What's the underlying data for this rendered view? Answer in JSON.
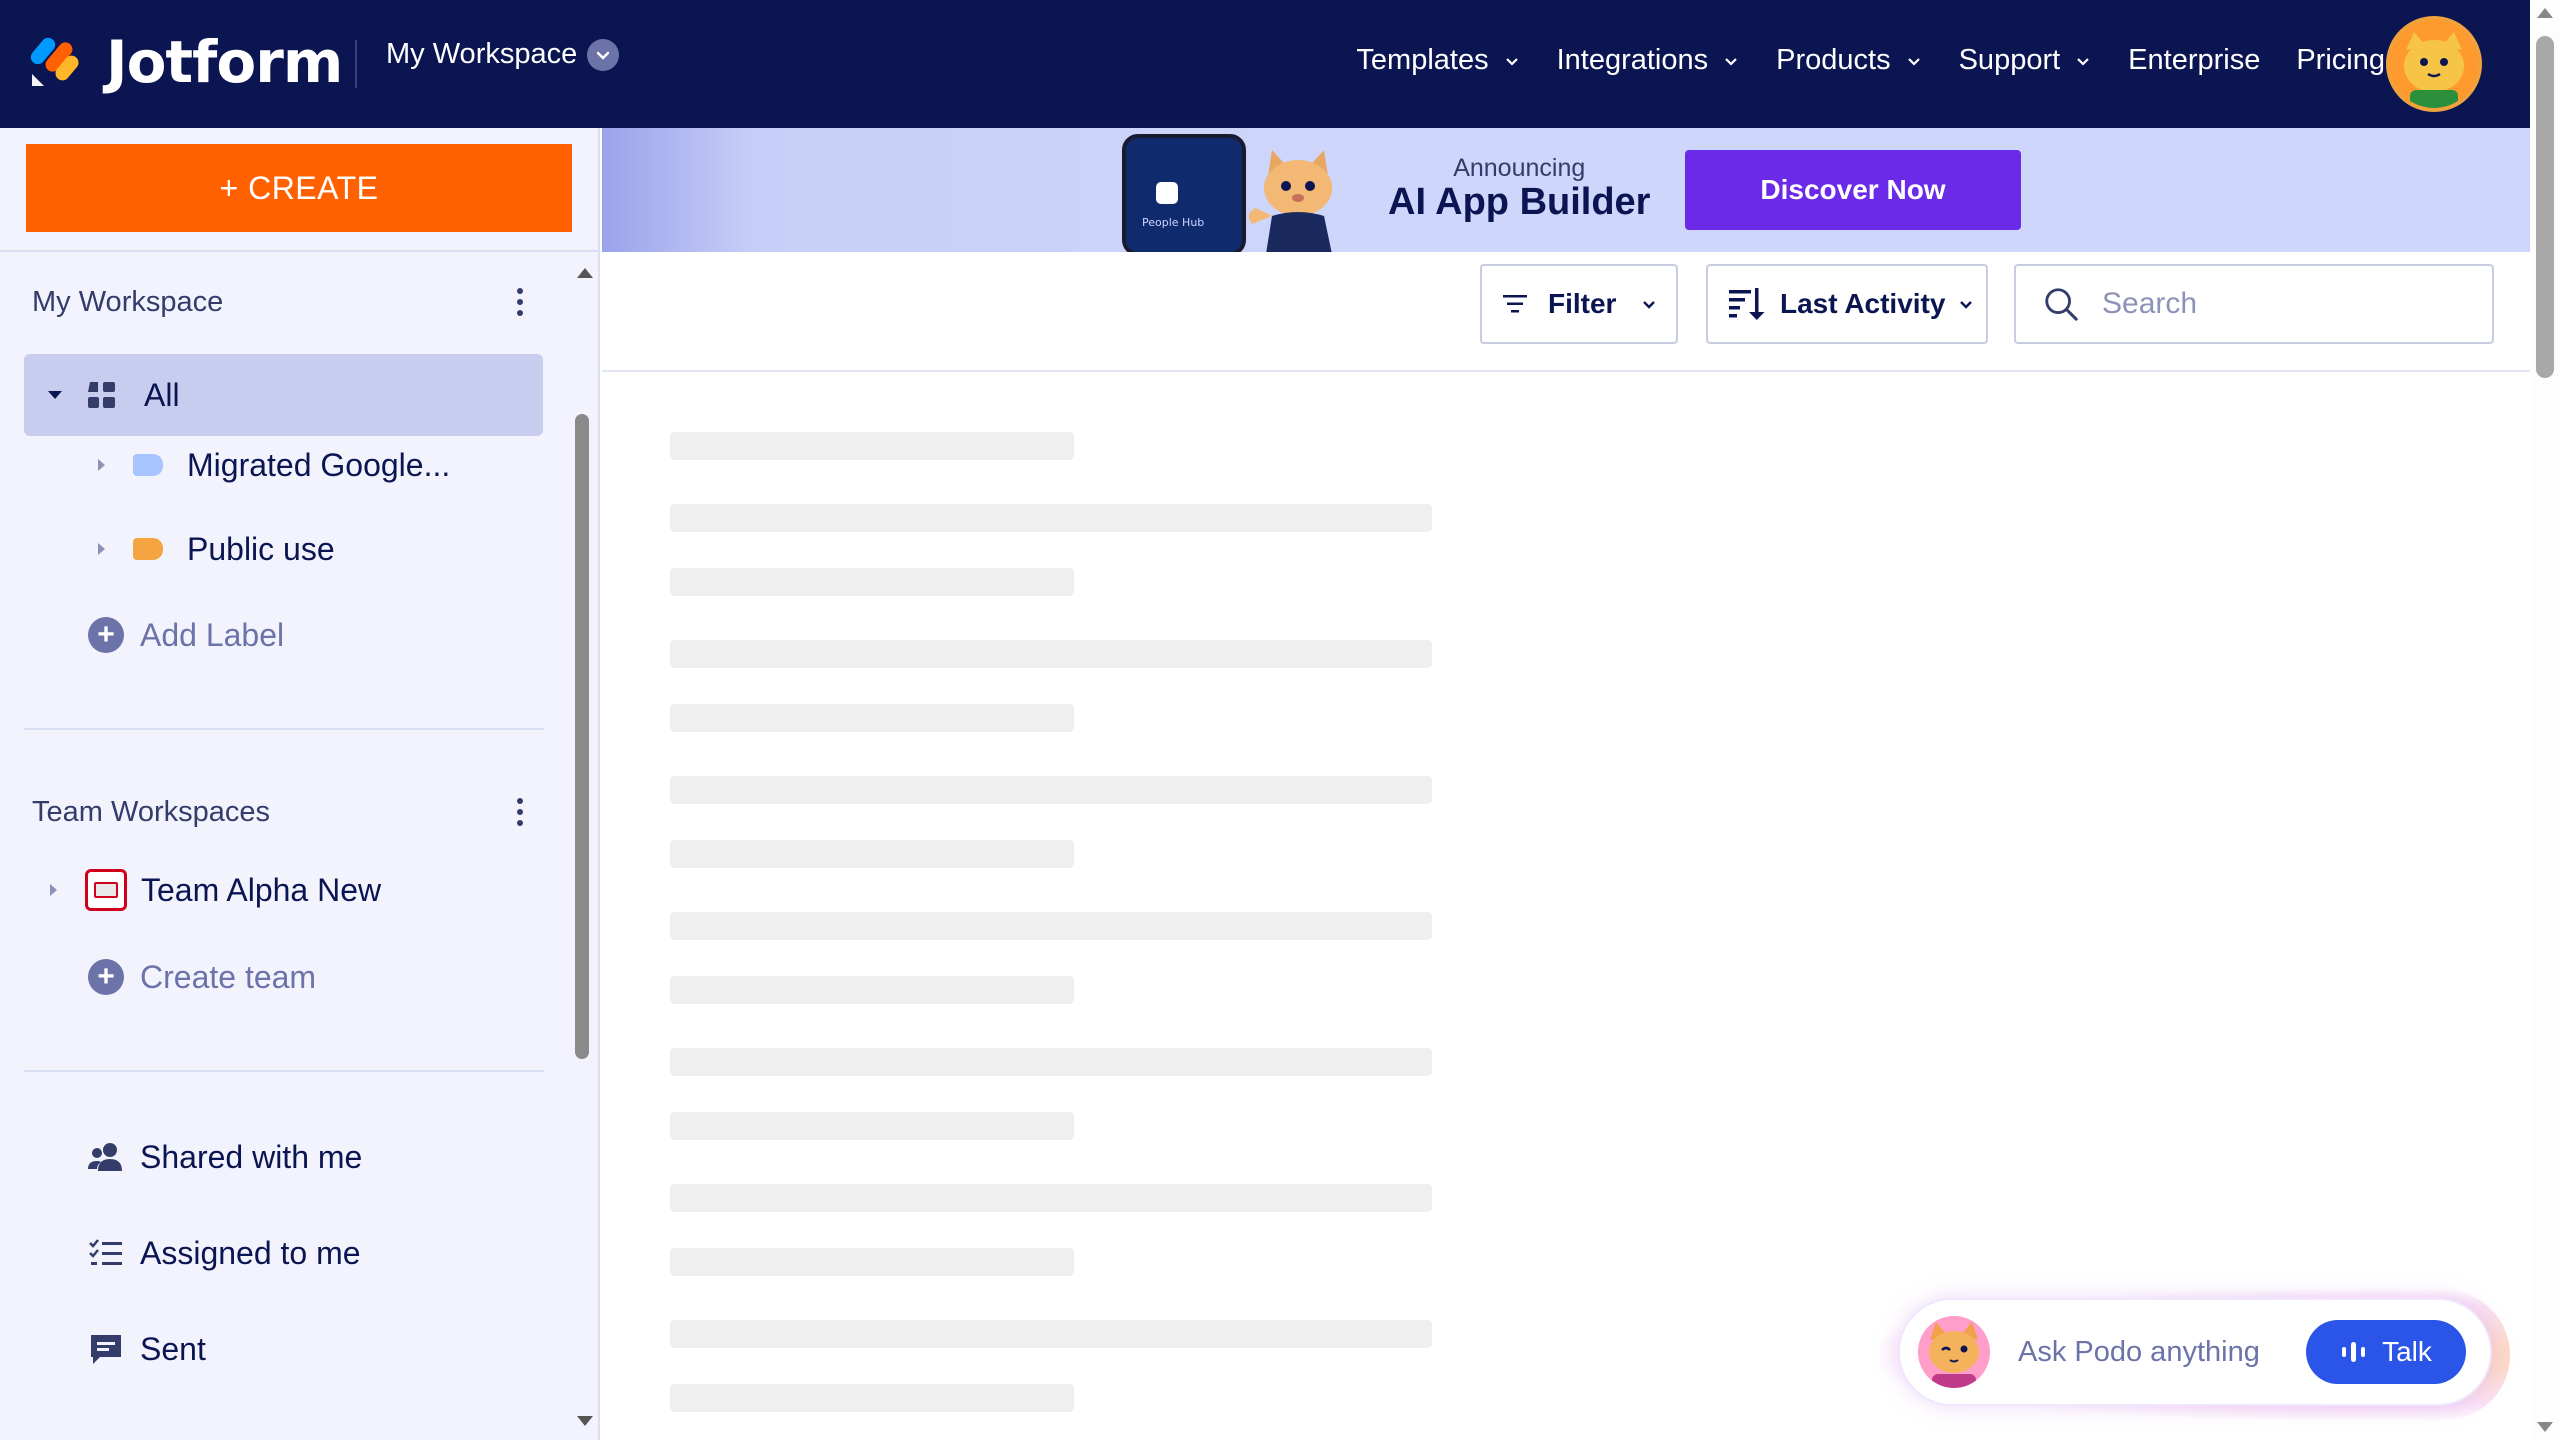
{
  "header": {
    "brand": "Jotform",
    "workspace": "My Workspace",
    "nav": [
      {
        "label": "Templates",
        "dropdown": true
      },
      {
        "label": "Integrations",
        "dropdown": true
      },
      {
        "label": "Products",
        "dropdown": true
      },
      {
        "label": "Support",
        "dropdown": true
      },
      {
        "label": "Enterprise",
        "dropdown": false
      },
      {
        "label": "Pricing",
        "dropdown": false
      }
    ]
  },
  "sidebar": {
    "create_label": "+ CREATE",
    "my_workspace": {
      "title": "My Workspace",
      "all": "All",
      "labels": [
        {
          "name": "Migrated Google...",
          "color": "#a8c4ff"
        },
        {
          "name": "Public use",
          "color": "#f5a442"
        }
      ],
      "add_label": "Add Label"
    },
    "team_workspaces": {
      "title": "Team Workspaces",
      "teams": [
        {
          "name": "Team Alpha New"
        }
      ],
      "create_team": "Create team"
    },
    "links": [
      {
        "label": "Shared with me",
        "icon": "people-icon"
      },
      {
        "label": "Assigned to me",
        "icon": "checklist-icon"
      },
      {
        "label": "Sent",
        "icon": "message-icon"
      }
    ]
  },
  "banner": {
    "announcing": "Announcing",
    "title": "AI App Builder",
    "cta": "Discover Now",
    "phone_text": "People Hub"
  },
  "toolbar": {
    "filter": "Filter",
    "sort": "Last Activity",
    "search_placeholder": "Search"
  },
  "podo": {
    "placeholder": "Ask Podo anything",
    "talk": "Talk"
  },
  "colors": {
    "header_bg": "#0a1551",
    "create": "#ff6100",
    "discover": "#6a2ae8",
    "talk": "#2a55e8",
    "active_item": "#c8cdef"
  }
}
